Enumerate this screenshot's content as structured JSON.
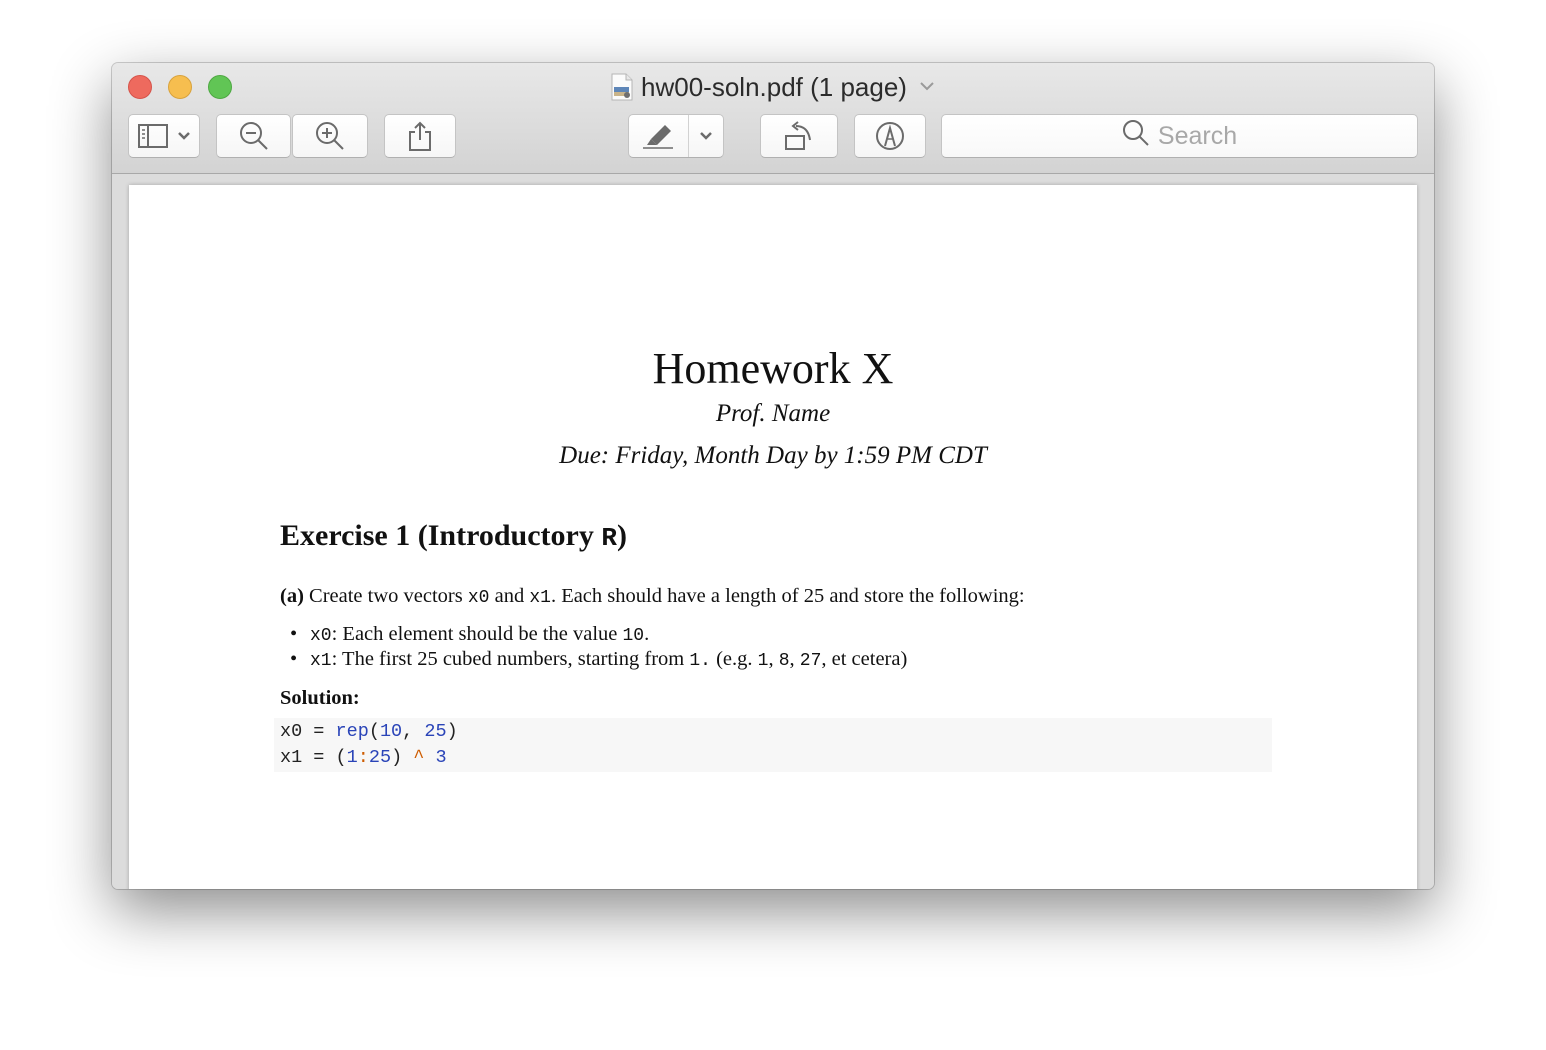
{
  "window": {
    "title": "hw00-soln.pdf (1 page)",
    "title_icon": "pdf-document-icon",
    "traffic_lights": [
      "close",
      "minimize",
      "maximize"
    ]
  },
  "toolbar": {
    "buttons": [
      {
        "name": "sidebar-toggle",
        "icon": "sidebar-icon",
        "has_dropdown": true
      },
      {
        "name": "zoom-out",
        "icon": "zoom-out-icon"
      },
      {
        "name": "zoom-in",
        "icon": "zoom-in-icon"
      },
      {
        "name": "share",
        "icon": "share-icon"
      },
      {
        "name": "highlight",
        "icon": "highlighter-icon",
        "has_dropdown": true
      },
      {
        "name": "rotate",
        "icon": "rotate-left-icon"
      },
      {
        "name": "markup",
        "icon": "markup-pen-icon"
      }
    ],
    "search": {
      "placeholder": "Search",
      "value": ""
    }
  },
  "document": {
    "title": "Homework X",
    "author": "Prof. Name",
    "due": "Due: Friday, Month Day by 1:59 PM CDT",
    "exercise_heading": {
      "text": "Exercise 1 (Introductory ",
      "code": "R",
      "close": ")"
    },
    "part_a": {
      "label": "(a)",
      "segments": [
        {
          "type": "text",
          "value": " Create two vectors "
        },
        {
          "type": "code",
          "value": "x0"
        },
        {
          "type": "text",
          "value": " and "
        },
        {
          "type": "code",
          "value": "x1"
        },
        {
          "type": "text",
          "value": ". Each should have a length of 25 and store the following:"
        }
      ]
    },
    "bullets": [
      {
        "code": "x0",
        "text": ": Each element should be the value ",
        "code2": "10",
        "text2": "."
      },
      {
        "code": "x1",
        "text": ": The first 25 cubed numbers, starting from ",
        "code2": "1.",
        "text2": " (e.g. ",
        "code3": "1",
        "text3": ", ",
        "code4": "8",
        "text4": ", ",
        "code5": "27",
        "text5": ", et cetera)"
      }
    ],
    "solution_label": "Solution:",
    "code": [
      [
        {
          "t": "plain",
          "v": "x0 = "
        },
        {
          "t": "kw",
          "v": "rep"
        },
        {
          "t": "plain",
          "v": "("
        },
        {
          "t": "num",
          "v": "10"
        },
        {
          "t": "plain",
          "v": ", "
        },
        {
          "t": "num",
          "v": "25"
        },
        {
          "t": "plain",
          "v": ")"
        }
      ],
      [
        {
          "t": "plain",
          "v": "x1 = ("
        },
        {
          "t": "num",
          "v": "1"
        },
        {
          "t": "op",
          "v": ":"
        },
        {
          "t": "num",
          "v": "25"
        },
        {
          "t": "plain",
          "v": ") "
        },
        {
          "t": "op",
          "v": "^"
        },
        {
          "t": "plain",
          "v": " "
        },
        {
          "t": "num",
          "v": "3"
        }
      ]
    ]
  },
  "colors": {
    "close": "#ee6a5e",
    "minimize": "#f6be4f",
    "maximize": "#61c555",
    "code_keyword": "#2a44b8",
    "code_operator": "#ce5c00",
    "code_bg": "#f7f7f7"
  }
}
